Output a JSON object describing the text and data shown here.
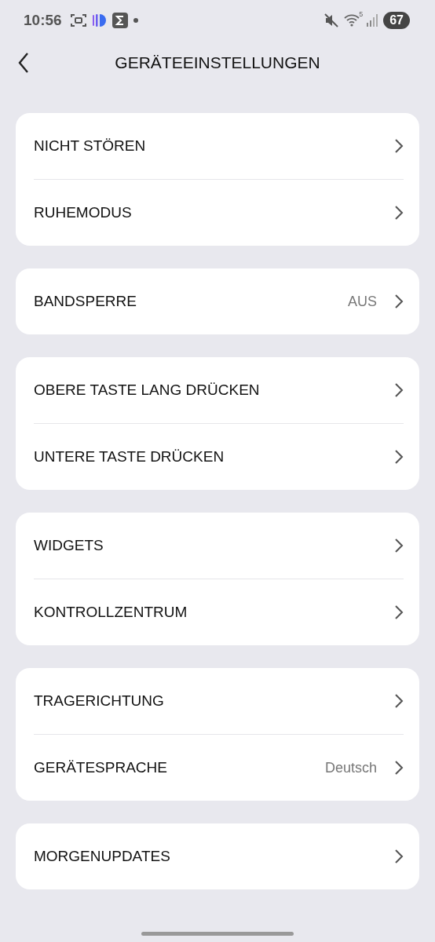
{
  "status_bar": {
    "time": "10:56",
    "wifi_label": "5",
    "battery": "67"
  },
  "header": {
    "title": "GERÄTEEINSTELLUNGEN"
  },
  "groups": [
    {
      "items": [
        {
          "label": "NICHT STÖREN"
        },
        {
          "label": "RUHEMODUS"
        }
      ]
    },
    {
      "items": [
        {
          "label": "BANDSPERRE",
          "value": "AUS"
        }
      ]
    },
    {
      "items": [
        {
          "label": "OBERE TASTE LANG DRÜCKEN"
        },
        {
          "label": "UNTERE TASTE DRÜCKEN"
        }
      ]
    },
    {
      "items": [
        {
          "label": "WIDGETS"
        },
        {
          "label": "KONTROLLZENTRUM"
        }
      ]
    },
    {
      "items": [
        {
          "label": "TRAGERICHTUNG"
        },
        {
          "label": "GERÄTESPRACHE",
          "value": "Deutsch"
        }
      ]
    },
    {
      "items": [
        {
          "label": "MORGENUPDATES"
        }
      ]
    }
  ]
}
